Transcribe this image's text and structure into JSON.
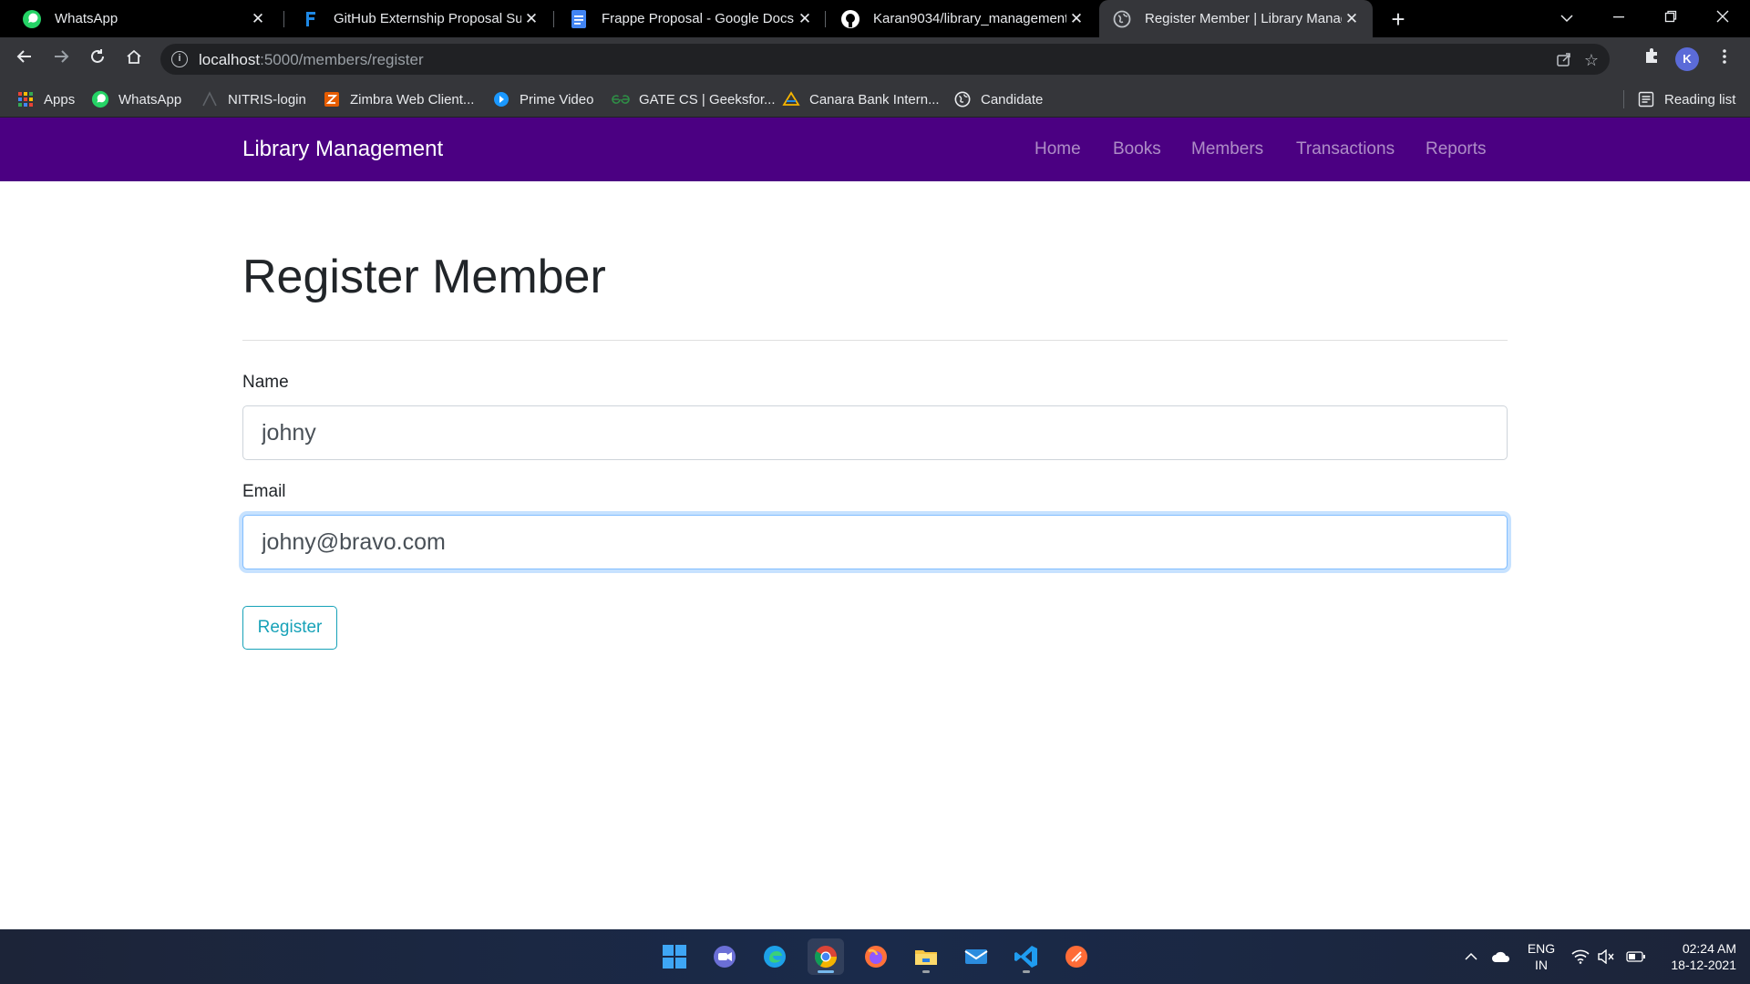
{
  "browser": {
    "tabs": [
      {
        "title": "WhatsApp",
        "icon": "whatsapp-icon"
      },
      {
        "title": "GitHub Externship Proposal Subm",
        "icon": "frappe-icon"
      },
      {
        "title": "Frappe Proposal - Google Docs",
        "icon": "google-docs-icon"
      },
      {
        "title": "Karan9034/library_management:",
        "icon": "github-icon"
      },
      {
        "title": "Register Member | Library Manag",
        "icon": "globe-icon",
        "active": true
      }
    ],
    "url_host": "localhost",
    "url_path": ":5000/members/register",
    "profile_initial": "K",
    "bookmarks": [
      {
        "label": "Apps",
        "icon": "apps-grid-icon"
      },
      {
        "label": "WhatsApp",
        "icon": "whatsapp-icon"
      },
      {
        "label": "NITRIS-login",
        "icon": "nitris-icon"
      },
      {
        "label": "Zimbra Web Client...",
        "icon": "zimbra-icon"
      },
      {
        "label": "Prime Video",
        "icon": "prime-video-icon"
      },
      {
        "label": "GATE CS | Geeksfor...",
        "icon": "geeksforgeeks-icon"
      },
      {
        "label": "Canara Bank Intern...",
        "icon": "canara-bank-icon"
      },
      {
        "label": "Candidate",
        "icon": "globe-icon"
      }
    ],
    "reading_list": "Reading list"
  },
  "app": {
    "brand": "Library Management",
    "nav": [
      "Home",
      "Books",
      "Members",
      "Transactions",
      "Reports"
    ],
    "nav_color": "#4b0082"
  },
  "form": {
    "heading": "Register Member",
    "name_label": "Name",
    "name_value": "johny",
    "email_label": "Email",
    "email_value": "johny@bravo.com",
    "submit_label": "Register",
    "submit_color": "#17a2b8"
  },
  "taskbar": {
    "lang_line1": "ENG",
    "lang_line2": "IN",
    "time": "02:24 AM",
    "date": "18-12-2021"
  }
}
